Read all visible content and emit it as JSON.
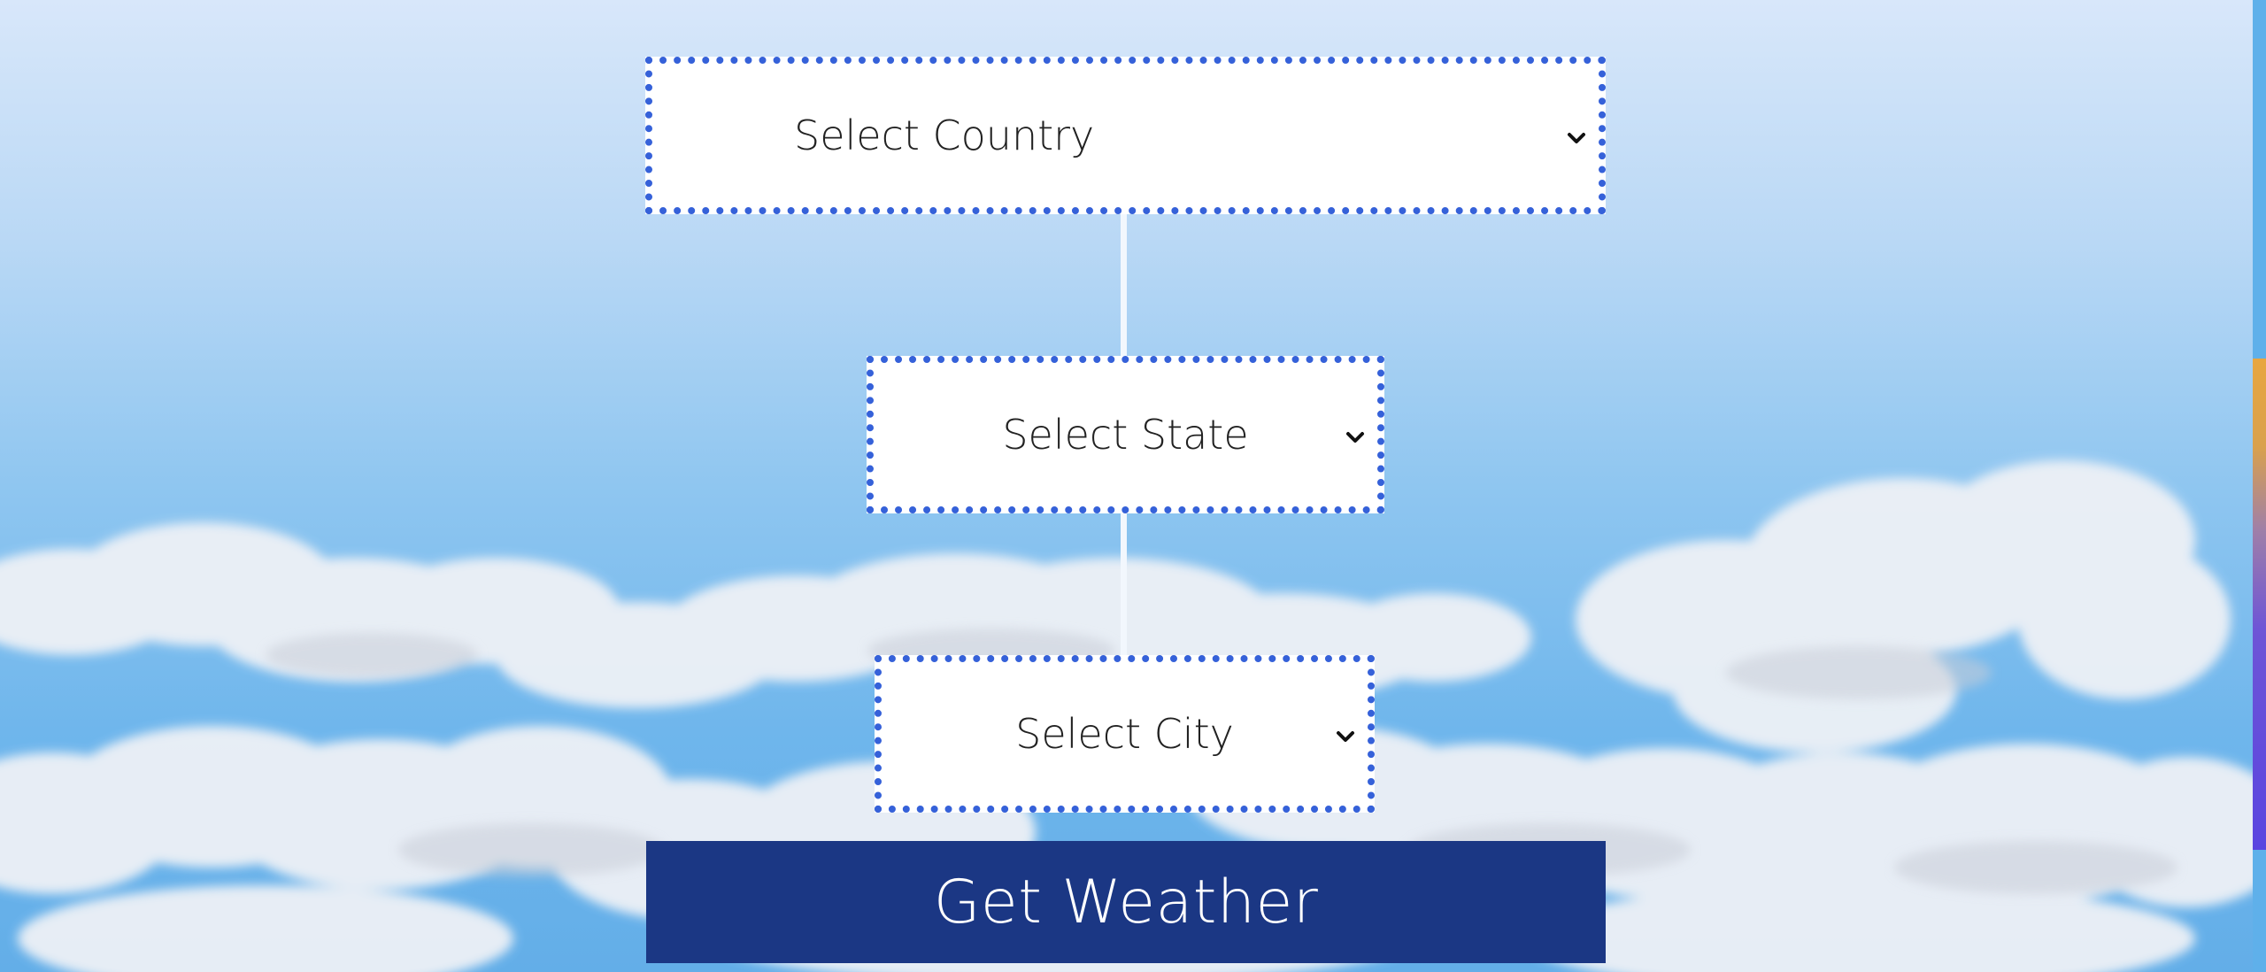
{
  "form": {
    "country_select": {
      "label": "Select Country"
    },
    "state_select": {
      "label": "Select State"
    },
    "city_select": {
      "label": "Select City"
    },
    "submit_label": "Get Weather"
  },
  "icons": {
    "dropdown": "chevron-down-icon"
  },
  "colors": {
    "select_border": "#3561d9",
    "button_background": "#1b3784",
    "button_text": "#ffffff",
    "sky_top": "#d8e7fa",
    "sky_bottom": "#63aee8"
  }
}
